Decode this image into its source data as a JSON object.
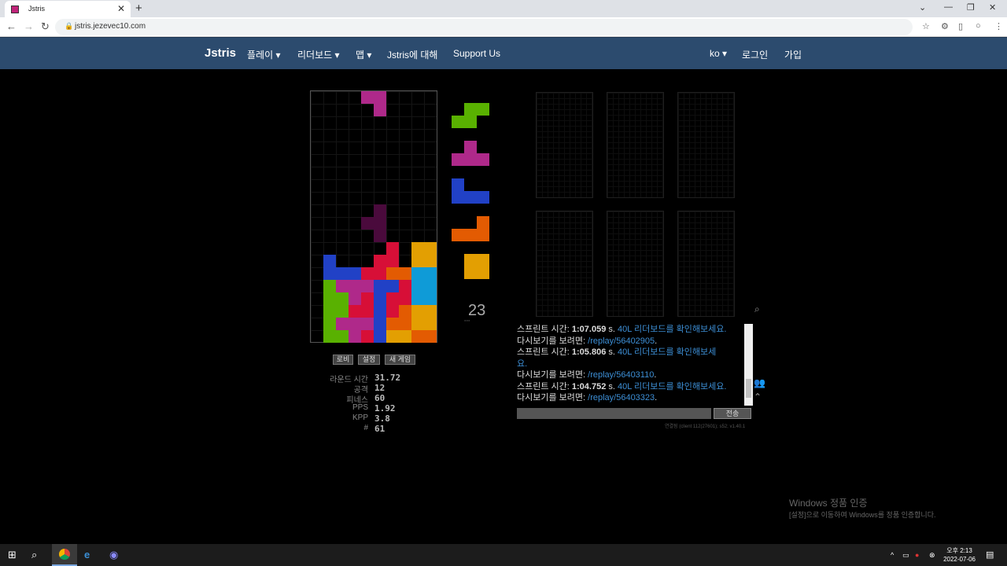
{
  "browser": {
    "tab_title": "Jstris",
    "url": "jstris.jezevec10.com"
  },
  "nav": {
    "brand": "Jstris",
    "items": [
      "플레이 ▾",
      "리더보드 ▾",
      "맵 ▾",
      "Jstris에 대해",
      "Support Us"
    ],
    "lang": "ko ▾",
    "login": "로그인",
    "signup": "가입"
  },
  "game": {
    "counter": "23",
    "buttons": {
      "lobby": "로비",
      "settings": "설정",
      "new_game": "새 게임"
    },
    "stats": [
      {
        "label": "라운드 시간",
        "value": "31.72"
      },
      {
        "label": "공격",
        "value": "12"
      },
      {
        "label": "피네스",
        "value": "60"
      },
      {
        "label": "PPS",
        "value": "1.92"
      },
      {
        "label": "KPP",
        "value": "3.8"
      },
      {
        "label": "#",
        "value": "61"
      }
    ],
    "colors": {
      "green": "#59b101",
      "magenta": "#af298a",
      "blue": "#2141c6",
      "orange": "#e35b02",
      "yellow": "#e39f02",
      "cyan": "#0f9bd7",
      "red": "#d70f37"
    }
  },
  "chat": {
    "lines": [
      {
        "prefix": "스프린트 시간: ",
        "time": "1:07.059",
        "mid": " s. ",
        "link": "40L 리더보드를 확인해보세요.",
        "tail": ""
      },
      {
        "prefix": "다시보기를 보려면: ",
        "time": "",
        "mid": "",
        "link": "/replay/56402905",
        "tail": "."
      },
      {
        "prefix": "스프린트 시간: ",
        "time": "1:05.806",
        "mid": " s. ",
        "link": "40L 리더보드를 확인해보세",
        "tail": ""
      },
      {
        "prefix": "",
        "time": "",
        "mid": "",
        "link": "요.",
        "tail": ""
      },
      {
        "prefix": "다시보기를 보려면: ",
        "time": "",
        "mid": "",
        "link": "/replay/56403110",
        "tail": "."
      },
      {
        "prefix": "스프린트 시간: ",
        "time": "1:04.752",
        "mid": " s. ",
        "link": "40L 리더보드를 확인해보세요.",
        "tail": ""
      },
      {
        "prefix": "다시보기를 보려면: ",
        "time": "",
        "mid": "",
        "link": "/replay/56403323",
        "tail": "."
      }
    ],
    "send": "전송",
    "conn": "연결됨 (client 112(27601); s52; v1.40.1"
  },
  "watermark": {
    "line1": "Windows 정품 인증",
    "line2": "[설정]으로 이동하여 Windows를 정품 인증합니다."
  },
  "taskbar": {
    "time": "오후 2:13",
    "date": "2022-07-06"
  }
}
